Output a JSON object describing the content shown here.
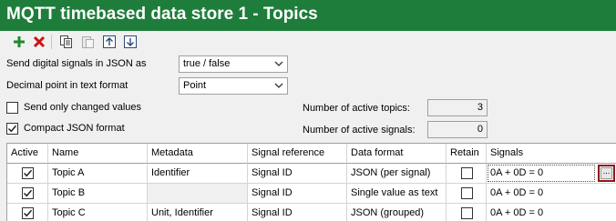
{
  "window": {
    "title": "MQTT timebased data store 1 - Topics"
  },
  "toolbar": {
    "icons": [
      "add-icon",
      "delete-icon",
      "copy-icon",
      "paste-icon",
      "move-up-icon",
      "move-down-icon"
    ],
    "colors": {
      "add": "#1e8a2e",
      "delete": "#d01010",
      "titlebar": "#1e7d3a"
    }
  },
  "settings": {
    "digital_signals_label": "Send digital signals in JSON as",
    "digital_signals_value": "true / false",
    "decimal_point_label": "Decimal point in text format",
    "decimal_point_value": "Point",
    "send_changed_label": "Send only changed values",
    "send_changed_checked": false,
    "compact_json_label": "Compact JSON format",
    "compact_json_checked": true,
    "active_topics_label": "Number of active topics:",
    "active_topics_value": "3",
    "active_signals_label": "Number of active signals:",
    "active_signals_value": "0"
  },
  "table": {
    "headers": {
      "active": "Active",
      "name": "Name",
      "metadata": "Metadata",
      "signal_reference": "Signal reference",
      "data_format": "Data format",
      "retain": "Retain",
      "signals": "Signals"
    },
    "rows": [
      {
        "active": true,
        "name": "Topic A",
        "metadata": "Identifier",
        "signal_reference": "Signal ID",
        "data_format": "JSON (per signal)",
        "retain": false,
        "signals": "0A + 0D = 0"
      },
      {
        "active": true,
        "name": "Topic B",
        "metadata": "",
        "signal_reference": "Signal ID",
        "data_format": "Single value as text",
        "retain": false,
        "signals": "0A + 0D = 0"
      },
      {
        "active": true,
        "name": "Topic C",
        "metadata": "Unit, Identifier",
        "signal_reference": "Signal ID",
        "data_format": "JSON (grouped)",
        "retain": false,
        "signals": "0A + 0D = 0"
      }
    ],
    "ellipsis_label": "..."
  }
}
